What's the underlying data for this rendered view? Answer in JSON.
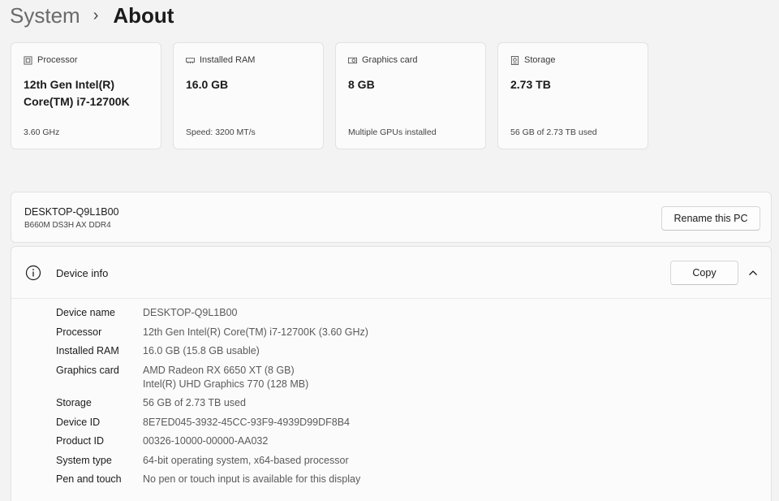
{
  "breadcrumb": {
    "parent": "System",
    "separator": "›",
    "current": "About"
  },
  "cards": [
    {
      "icon": "processor-icon",
      "label": "Processor",
      "value": "12th Gen Intel(R) Core(TM) i7-12700K",
      "sub": "3.60 GHz"
    },
    {
      "icon": "ram-icon",
      "label": "Installed RAM",
      "value": "16.0 GB",
      "sub": "Speed: 3200 MT/s"
    },
    {
      "icon": "graphics-card-icon",
      "label": "Graphics card",
      "value": "8 GB",
      "sub": "Multiple GPUs installed"
    },
    {
      "icon": "storage-icon",
      "label": "Storage",
      "value": "2.73 TB",
      "sub": "56 GB of 2.73 TB used"
    }
  ],
  "pc": {
    "name": "DESKTOP-Q9L1B00",
    "model": "B660M DS3H AX DDR4",
    "rename_label": "Rename this PC"
  },
  "device_info": {
    "title": "Device info",
    "copy_label": "Copy",
    "rows": [
      {
        "key": "Device name",
        "value": "DESKTOP-Q9L1B00"
      },
      {
        "key": "Processor",
        "value": "12th Gen Intel(R) Core(TM) i7-12700K (3.60 GHz)"
      },
      {
        "key": "Installed RAM",
        "value": "16.0 GB (15.8 GB usable)"
      },
      {
        "key": "Graphics card",
        "value": "AMD Radeon RX 6650 XT (8 GB)",
        "value2": "Intel(R) UHD Graphics 770 (128 MB)"
      },
      {
        "key": "Storage",
        "value": "56 GB of 2.73 TB used"
      },
      {
        "key": "Device ID",
        "value": "8E7ED045-3932-45CC-93F9-4939D99DF8B4"
      },
      {
        "key": "Product ID",
        "value": "00326-10000-00000-AA032"
      },
      {
        "key": "System type",
        "value": "64-bit operating system, x64-based processor"
      },
      {
        "key": "Pen and touch",
        "value": "No pen or touch input is available for this display"
      }
    ]
  }
}
